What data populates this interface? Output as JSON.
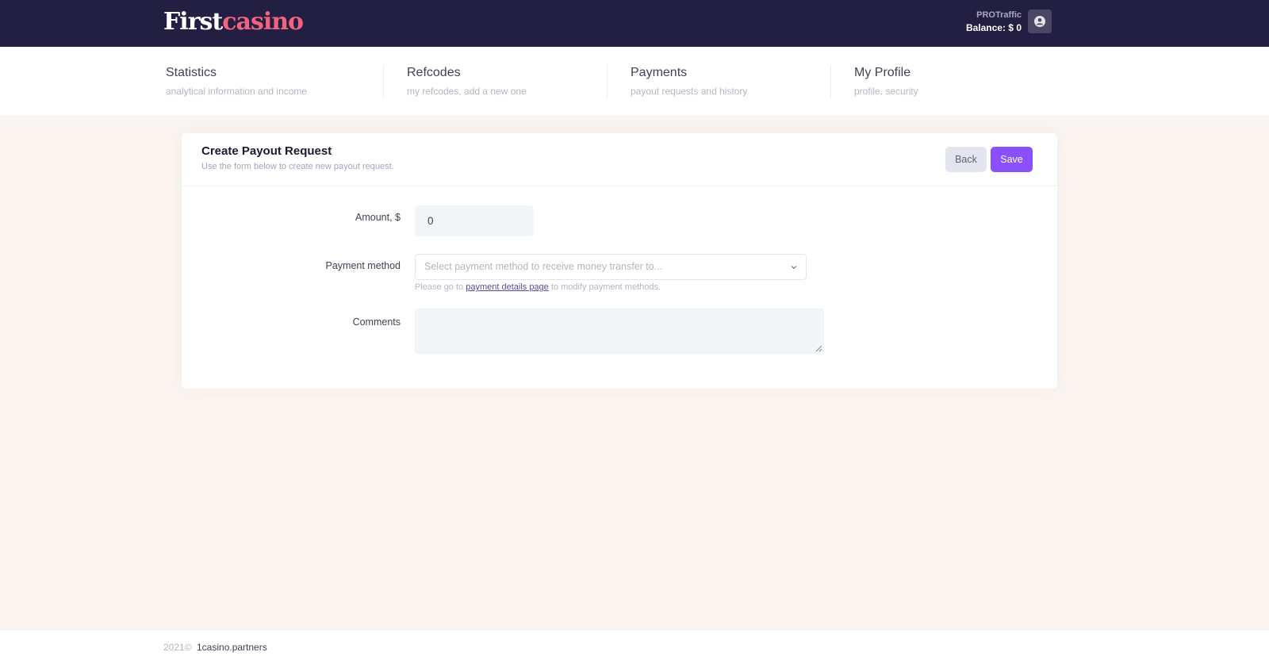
{
  "header": {
    "logo_first": "First",
    "logo_casino": "casino",
    "user_name": "PROTraffic",
    "balance": "Balance: $ 0",
    "avatar_icon": "user-icon",
    "colors": {
      "background": "#231f43",
      "logo_accent": "#f2637f"
    }
  },
  "nav": [
    {
      "title": "Statistics",
      "subtitle": "analytical information and income"
    },
    {
      "title": "Refcodes",
      "subtitle": "my refcodes, add a new one"
    },
    {
      "title": "Payments",
      "subtitle": "payout requests and history"
    },
    {
      "title": "My Profile",
      "subtitle": "profile, security"
    }
  ],
  "card": {
    "title": "Create Payout Request",
    "subtitle": "Use the form below to create new payout request.",
    "back_label": "Back",
    "save_label": "Save",
    "save_color": "#8950fc"
  },
  "form": {
    "amount_label": "Amount, $",
    "amount_value": "0",
    "payment_method_label": "Payment method",
    "payment_method_placeholder": "Select payment method to receive money transfer to...",
    "help_prefix": "Please go to ",
    "help_link": "payment details page",
    "help_suffix": " to modify payment methods.",
    "comments_label": "Comments",
    "comments_value": ""
  },
  "footer": {
    "year": "2021©",
    "site": "1casino.partners"
  }
}
